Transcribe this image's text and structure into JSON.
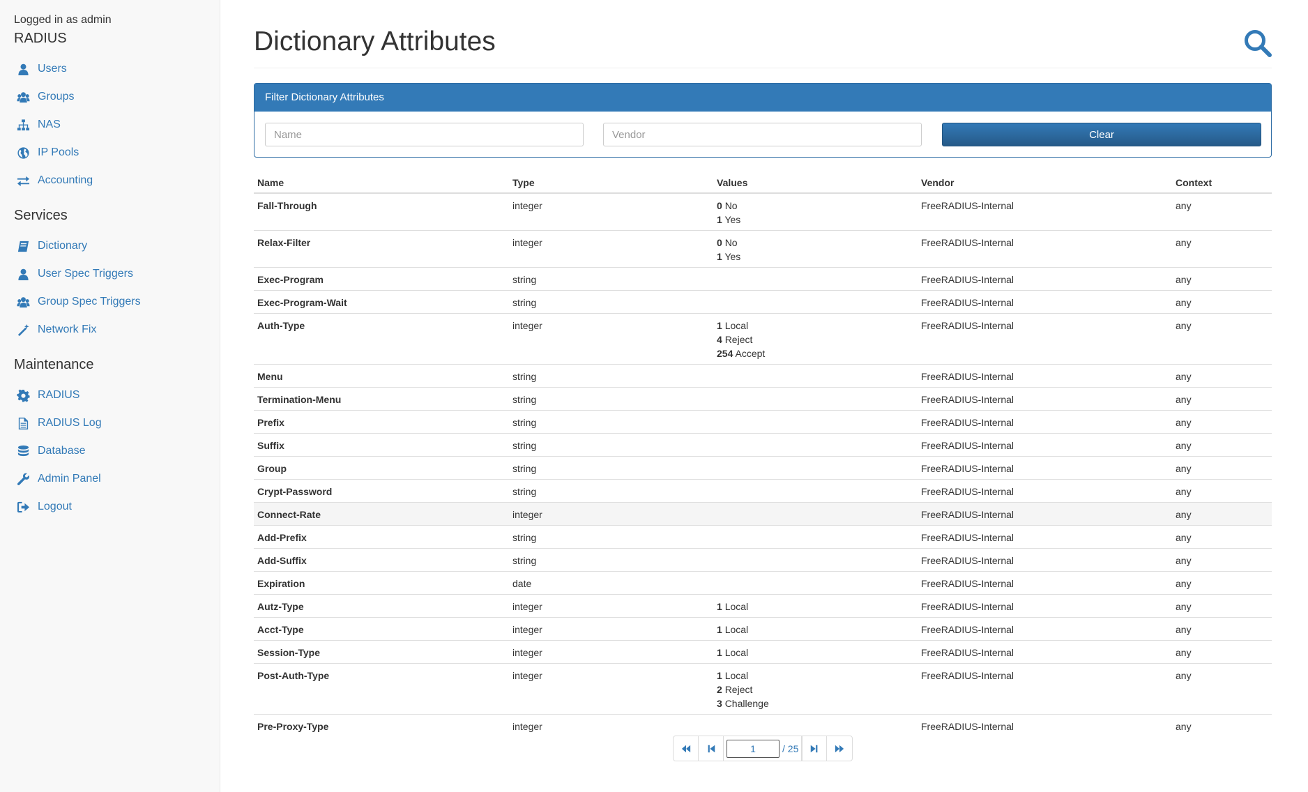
{
  "sidebar": {
    "logged_in": "Logged in as admin",
    "sections": [
      {
        "title": "RADIUS",
        "items": [
          {
            "label": "Users",
            "icon": "user-icon"
          },
          {
            "label": "Groups",
            "icon": "users-icon"
          },
          {
            "label": "NAS",
            "icon": "sitemap-icon"
          },
          {
            "label": "IP Pools",
            "icon": "globe-icon"
          },
          {
            "label": "Accounting",
            "icon": "exchange-icon"
          }
        ]
      },
      {
        "title": "Services",
        "items": [
          {
            "label": "Dictionary",
            "icon": "book-icon"
          },
          {
            "label": "User Spec Triggers",
            "icon": "user-icon"
          },
          {
            "label": "Group Spec Triggers",
            "icon": "users-icon"
          },
          {
            "label": "Network Fix",
            "icon": "magic-wand-icon"
          }
        ]
      },
      {
        "title": "Maintenance",
        "items": [
          {
            "label": "RADIUS",
            "icon": "gear-icon"
          },
          {
            "label": "RADIUS Log",
            "icon": "file-icon"
          },
          {
            "label": "Database",
            "icon": "database-icon"
          },
          {
            "label": "Admin Panel",
            "icon": "wrench-icon"
          },
          {
            "label": "Logout",
            "icon": "sign-out-icon"
          }
        ]
      }
    ]
  },
  "header": {
    "title": "Dictionary Attributes",
    "search_icon": "search-icon"
  },
  "filter": {
    "title": "Filter Dictionary Attributes",
    "name_placeholder": "Name",
    "vendor_placeholder": "Vendor",
    "clear_label": "Clear"
  },
  "table": {
    "columns": [
      "Name",
      "Type",
      "Values",
      "Vendor",
      "Context"
    ],
    "rows": [
      {
        "name": "Fall-Through",
        "type": "integer",
        "values": [
          {
            "k": "0",
            "v": "No"
          },
          {
            "k": "1",
            "v": "Yes"
          }
        ],
        "vendor": "FreeRADIUS-Internal",
        "context": "any"
      },
      {
        "name": "Relax-Filter",
        "type": "integer",
        "values": [
          {
            "k": "0",
            "v": "No"
          },
          {
            "k": "1",
            "v": "Yes"
          }
        ],
        "vendor": "FreeRADIUS-Internal",
        "context": "any"
      },
      {
        "name": "Exec-Program",
        "type": "string",
        "values": [],
        "vendor": "FreeRADIUS-Internal",
        "context": "any"
      },
      {
        "name": "Exec-Program-Wait",
        "type": "string",
        "values": [],
        "vendor": "FreeRADIUS-Internal",
        "context": "any"
      },
      {
        "name": "Auth-Type",
        "type": "integer",
        "values": [
          {
            "k": "1",
            "v": "Local"
          },
          {
            "k": "4",
            "v": "Reject"
          },
          {
            "k": "254",
            "v": "Accept"
          }
        ],
        "vendor": "FreeRADIUS-Internal",
        "context": "any"
      },
      {
        "name": "Menu",
        "type": "string",
        "values": [],
        "vendor": "FreeRADIUS-Internal",
        "context": "any"
      },
      {
        "name": "Termination-Menu",
        "type": "string",
        "values": [],
        "vendor": "FreeRADIUS-Internal",
        "context": "any"
      },
      {
        "name": "Prefix",
        "type": "string",
        "values": [],
        "vendor": "FreeRADIUS-Internal",
        "context": "any"
      },
      {
        "name": "Suffix",
        "type": "string",
        "values": [],
        "vendor": "FreeRADIUS-Internal",
        "context": "any"
      },
      {
        "name": "Group",
        "type": "string",
        "values": [],
        "vendor": "FreeRADIUS-Internal",
        "context": "any"
      },
      {
        "name": "Crypt-Password",
        "type": "string",
        "values": [],
        "vendor": "FreeRADIUS-Internal",
        "context": "any"
      },
      {
        "name": "Connect-Rate",
        "type": "integer",
        "values": [],
        "vendor": "FreeRADIUS-Internal",
        "context": "any",
        "highlight": true
      },
      {
        "name": "Add-Prefix",
        "type": "string",
        "values": [],
        "vendor": "FreeRADIUS-Internal",
        "context": "any"
      },
      {
        "name": "Add-Suffix",
        "type": "string",
        "values": [],
        "vendor": "FreeRADIUS-Internal",
        "context": "any"
      },
      {
        "name": "Expiration",
        "type": "date",
        "values": [],
        "vendor": "FreeRADIUS-Internal",
        "context": "any"
      },
      {
        "name": "Autz-Type",
        "type": "integer",
        "values": [
          {
            "k": "1",
            "v": "Local"
          }
        ],
        "vendor": "FreeRADIUS-Internal",
        "context": "any"
      },
      {
        "name": "Acct-Type",
        "type": "integer",
        "values": [
          {
            "k": "1",
            "v": "Local"
          }
        ],
        "vendor": "FreeRADIUS-Internal",
        "context": "any"
      },
      {
        "name": "Session-Type",
        "type": "integer",
        "values": [
          {
            "k": "1",
            "v": "Local"
          }
        ],
        "vendor": "FreeRADIUS-Internal",
        "context": "any"
      },
      {
        "name": "Post-Auth-Type",
        "type": "integer",
        "values": [
          {
            "k": "1",
            "v": "Local"
          },
          {
            "k": "2",
            "v": "Reject"
          },
          {
            "k": "3",
            "v": "Challenge"
          }
        ],
        "vendor": "FreeRADIUS-Internal",
        "context": "any"
      },
      {
        "name": "Pre-Proxy-Type",
        "type": "integer",
        "values": [],
        "vendor": "FreeRADIUS-Internal",
        "context": "any"
      }
    ]
  },
  "pagination": {
    "current_page": "1",
    "total_label": "/ 25"
  },
  "colors": {
    "accent": "#337ab7",
    "sidebar_bg": "#f8f8f8",
    "panel_head": "#337ab7"
  }
}
